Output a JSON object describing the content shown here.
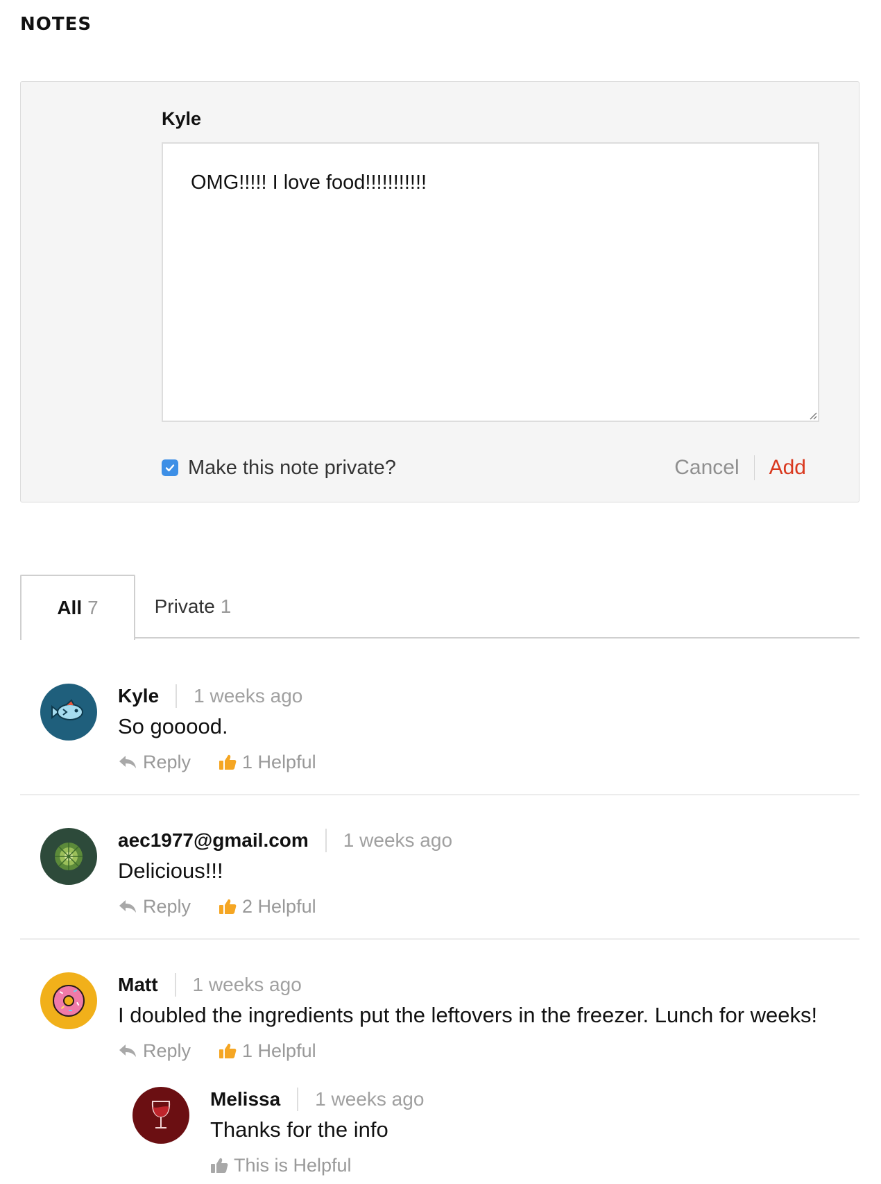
{
  "section": {
    "title": "NOTES"
  },
  "composer": {
    "author": "Kyle",
    "text": "OMG!!!!! I love food!!!!!!!!!!!",
    "private_label": "Make this note private?",
    "private_checked": true,
    "cancel_label": "Cancel",
    "add_label": "Add"
  },
  "tabs": [
    {
      "label": "All",
      "count": "7",
      "active": true
    },
    {
      "label": "Private",
      "count": "1",
      "active": false
    }
  ],
  "comments": [
    {
      "author": "Kyle",
      "time": "1 weeks ago",
      "text": "So gooood.",
      "reply_label": "Reply",
      "helpful_label": "1 Helpful",
      "avatar_icon": "fish-icon"
    },
    {
      "author": "aec1977@gmail.com",
      "time": "1 weeks ago",
      "text": "Delicious!!!",
      "reply_label": "Reply",
      "helpful_label": "2 Helpful",
      "avatar_icon": "cabbage-icon"
    },
    {
      "author": "Matt",
      "time": "1 weeks ago",
      "text": "I doubled the ingredients put the leftovers in the freezer. Lunch for weeks!",
      "reply_label": "Reply",
      "helpful_label": "1 Helpful",
      "avatar_icon": "donut-icon",
      "replies": [
        {
          "author": "Melissa",
          "time": "1 weeks ago",
          "text": "Thanks for the info",
          "helpful_label": "This is Helpful",
          "avatar_icon": "wine-glass-icon"
        }
      ]
    }
  ],
  "colors": {
    "accent_red": "#d9381e",
    "checkbox_blue": "#3d8fe6",
    "helpful_orange": "#f5a623",
    "muted_gray": "#999999"
  }
}
